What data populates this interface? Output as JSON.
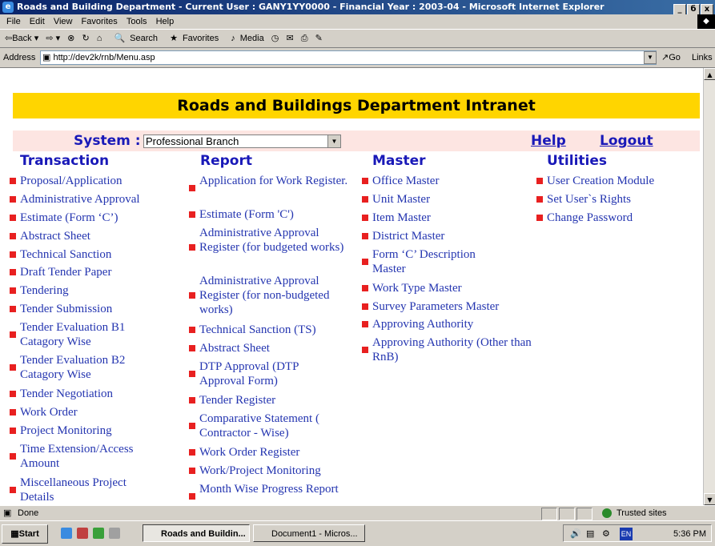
{
  "window": {
    "title": "Roads and Building Department - Current User : GANY1YY0000 - Financial Year : 2003-04 - Microsoft Internet Explorer",
    "controls": [
      "_",
      "б",
      "x"
    ]
  },
  "menubar": [
    "File",
    "Edit",
    "View",
    "Favorites",
    "Tools",
    "Help"
  ],
  "toolbar": {
    "back": "⇦Back ▾",
    "forward": "⇨ ▾",
    "search": "Search",
    "favorites": "Favorites",
    "media": "Media"
  },
  "address": {
    "label": "Address",
    "url": "http://dev2k/rnb/Menu.asp",
    "go": "Go",
    "links": "Links"
  },
  "page": {
    "banner": "Roads and Buildings Department Intranet",
    "system_label": "System :",
    "system_value": "Professional Branch",
    "help": "Help",
    "logout": "Logout",
    "columns": {
      "transaction": {
        "title": "Transaction",
        "items": [
          "Proposal/Application",
          "Administrative Approval",
          "Estimate (Form ‘C’)",
          "Abstract Sheet",
          "Technical Sanction",
          "Draft Tender Paper",
          "Tendering",
          "Tender Submission",
          "Tender Evaluation B1 Catagory Wise",
          "Tender Evaluation B2 Catagory Wise",
          "Tender Negotiation",
          "Work Order",
          "Project Monitoring",
          "Time Extension/Access Amount",
          "Miscellaneous Project Details"
        ]
      },
      "report": {
        "title": "Report",
        "items": [
          "Application for Work Register.",
          "Estimate (Form 'C')",
          "Administrative Approval Register (for budgeted works)",
          "Administrative Approval Register (for non-budgeted works)",
          "Technical Sanction (TS)",
          "Abstract Sheet",
          "DTP Approval (DTP Approval Form)",
          "Tender Register",
          "Comparative Statement ( Contractor - Wise)",
          "Work Order Register",
          "Work/Project Monitoring",
          "Month Wise Progress Report"
        ]
      },
      "master": {
        "title": "Master",
        "items": [
          "Office Master",
          "Unit Master",
          "Item Master",
          "District Master",
          "Form ‘C’ Description Master",
          "Work Type Master",
          "Survey Parameters Master",
          "Approving Authority",
          "Approving Authority (Other than RnB)"
        ]
      },
      "utilities": {
        "title": "Utilities",
        "items": [
          "User Creation Module",
          "Set User`s Rights",
          "Change Password"
        ]
      }
    }
  },
  "status": {
    "text": "Done",
    "zone": "Trusted sites"
  },
  "taskbar": {
    "start": "Start",
    "tasks": [
      "Roads and Buildin...",
      "Document1 - Micros..."
    ],
    "clock": "5:36 PM",
    "lang": "EN"
  },
  "colors": {
    "banner_bg": "#ffd500",
    "sysbar_bg": "#fde5e2",
    "heading": "#1919b8",
    "link": "#2435b0",
    "bullet": "#e82020"
  }
}
